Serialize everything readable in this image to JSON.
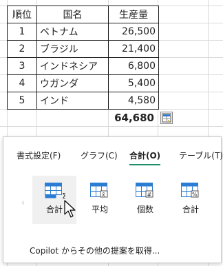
{
  "table": {
    "headers": [
      "順位",
      "国名",
      "生産量"
    ],
    "rows": [
      {
        "rank": "1",
        "country": "ベトナム",
        "amount": "26,500"
      },
      {
        "rank": "2",
        "country": "ブラジル",
        "amount": "21,400"
      },
      {
        "rank": "3",
        "country": "インドネシア",
        "amount": "6,800"
      },
      {
        "rank": "4",
        "country": "ウガンダ",
        "amount": "5,400"
      },
      {
        "rank": "5",
        "country": "インド",
        "amount": "4,580"
      }
    ],
    "total": "64,680"
  },
  "quick_analysis": {
    "button_icon": "quick-analysis-icon",
    "tabs": [
      {
        "label": "書式設定(F)",
        "active": false
      },
      {
        "label": "グラフ(C)",
        "active": false
      },
      {
        "label": "合計(O)",
        "active": true
      },
      {
        "label": "テーブル(T)",
        "active": false
      }
    ],
    "scroll_left_glyph": "‹",
    "tiles": [
      {
        "label": "合計",
        "icon": "sum-icon",
        "symbol": "Σ",
        "selected": true
      },
      {
        "label": "平均",
        "icon": "average-icon",
        "symbol": "x̄",
        "selected": false
      },
      {
        "label": "個数",
        "icon": "count-icon",
        "symbol": "#",
        "selected": false
      },
      {
        "label": "合計",
        "icon": "percent-total-icon",
        "symbol": "%",
        "selected": false
      }
    ],
    "footer": "Copilot からその他の提案を取得..."
  },
  "colors": {
    "accent": "#1f8f6a",
    "icon_blue": "#2b7cd3",
    "grid": "#dadada"
  }
}
